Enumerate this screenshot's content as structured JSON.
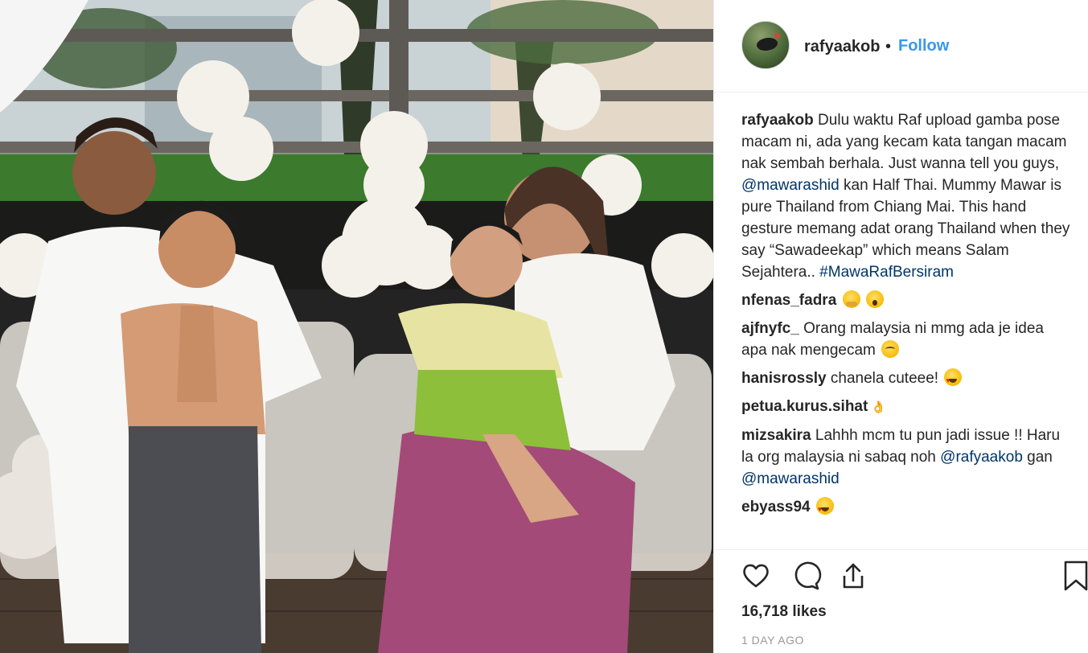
{
  "post": {
    "username": "rafyaakob",
    "separator": "•",
    "follow_label": "Follow"
  },
  "caption": {
    "username": "rafyaakob",
    "text_before": " Dulu waktu Raf upload gamba pose macam ni, ada yang kecam kata tangan macam nak sembah berhala. Just wanna tell you guys, ",
    "mention": "@mawarashid",
    "text_after": " kan Half Thai. Mummy Mawar is pure Thailand from Chiang Mai. This hand gesture memang adat orang Thailand when they say “Sawadeekap” which means Salam Sejahtera.. ",
    "hashtag": "#MawaRafBersiram"
  },
  "comments": [
    {
      "user": "nfenas_fadra",
      "text": "",
      "emojis": [
        "hugging-face-emoji",
        "astonished-face-emoji"
      ]
    },
    {
      "user": "ajfnyfc_",
      "text": " Orang malaysia ni mmg ada je idea apa nak mengecam ",
      "emojis": [
        "relieved-face-emoji"
      ]
    },
    {
      "user": "hanisrossly",
      "text": " chanela cuteee! ",
      "emojis": [
        "heart-eyes-emoji"
      ]
    },
    {
      "user": "petua.kurus.sihat",
      "text": "",
      "emojis": [
        "ok-hand-emoji"
      ]
    },
    {
      "user": "mizsakira",
      "text": " Lahhh mcm tu pun jadi issue !! Haru la org malaysia ni sabaq noh ",
      "mention1": "@rafyaakob",
      "middle": " gan ",
      "mention2": "@mawarashid"
    },
    {
      "user": "ebyass94",
      "text": " ",
      "emojis": [
        "heart-eyes-emoji"
      ]
    }
  ],
  "actions": {
    "like_icon": "heart-outline-icon",
    "comment_icon": "comment-bubble-icon",
    "share_icon": "share-upload-icon",
    "save_icon": "bookmark-icon"
  },
  "likes_text": "16,718 likes",
  "time_ago": "1 DAY AGO",
  "colors": {
    "link_blue": "#3897f0",
    "mention_navy": "#003569",
    "text": "#262626",
    "muted": "#999999"
  }
}
